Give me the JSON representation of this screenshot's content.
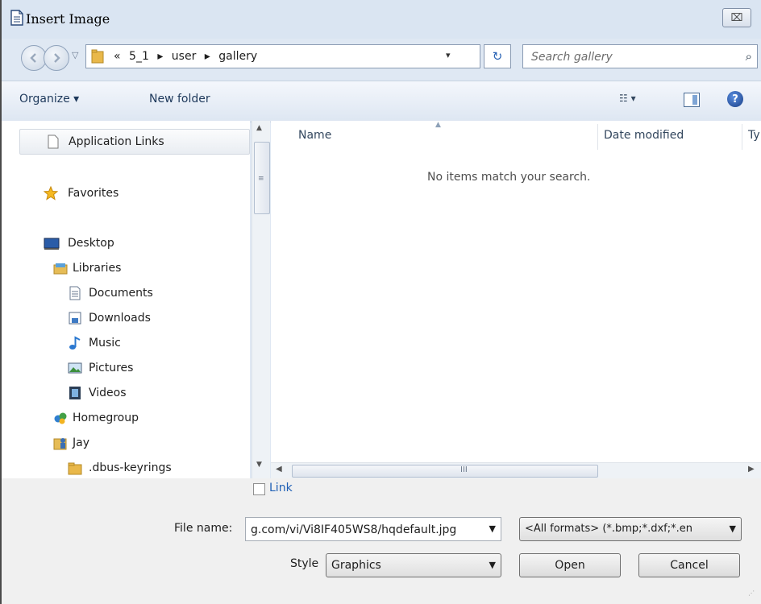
{
  "window": {
    "title": "Insert Image",
    "close_glyph": "⌧",
    "icons": {
      "title": "document-icon",
      "close": "close-icon"
    }
  },
  "address": {
    "overflow": "«",
    "breadcrumb": [
      "5_1",
      "user",
      "gallery"
    ],
    "separator": "▸",
    "dropdown_glyph": "▾",
    "refresh_glyph": "↻",
    "history_glyph": "▽"
  },
  "search": {
    "placeholder": "Search gallery",
    "icon_glyph": "⌕"
  },
  "toolbar": {
    "organize_label": "Organize ▾",
    "new_folder_label": "New folder",
    "view_glyph": "☷ ▾",
    "help_glyph": "?"
  },
  "nav": {
    "items": [
      {
        "label": "Application Links",
        "icon": "page-icon"
      },
      {
        "label": "Favorites",
        "icon": "star-icon"
      },
      {
        "label": "Desktop",
        "icon": "desktop-icon"
      },
      {
        "label": "Libraries",
        "icon": "libraries-icon"
      },
      {
        "label": "Documents",
        "icon": "documents-icon"
      },
      {
        "label": "Downloads",
        "icon": "downloads-icon"
      },
      {
        "label": "Music",
        "icon": "music-icon"
      },
      {
        "label": "Pictures",
        "icon": "pictures-icon"
      },
      {
        "label": "Videos",
        "icon": "videos-icon"
      },
      {
        "label": "Homegroup",
        "icon": "homegroup-icon"
      },
      {
        "label": "Jay",
        "icon": "user-folder-icon"
      },
      {
        "label": ".dbus-keyrings",
        "icon": "folder-icon"
      }
    ],
    "scroll_up": "▲",
    "scroll_down": "▼",
    "scroll_grip": "≡"
  },
  "files": {
    "columns": [
      "Name",
      "Date modified",
      "Ty"
    ],
    "sort_indicator": "▲",
    "empty_message": "No items match your search.",
    "scroll_left": "◀",
    "scroll_right": "▶",
    "scroll_grip": "III"
  },
  "form": {
    "link_label": "Link",
    "link_checked": false,
    "file_name_label": "File name:",
    "file_name_value": "g.com/vi/Vi8IF405WS8/hqdefault.jpg",
    "format_value": "<All formats> (*.bmp;*.dxf;*.en",
    "style_label": "Style",
    "style_value": "Graphics",
    "open_label": "Open",
    "cancel_label": "Cancel",
    "combo_arrow": "▼",
    "resize_grip": "⋰"
  },
  "colors": {
    "window_bg": "#dfe8f3",
    "link_blue": "#1e5fb5",
    "bottom_bg": "#f0f0f0"
  }
}
